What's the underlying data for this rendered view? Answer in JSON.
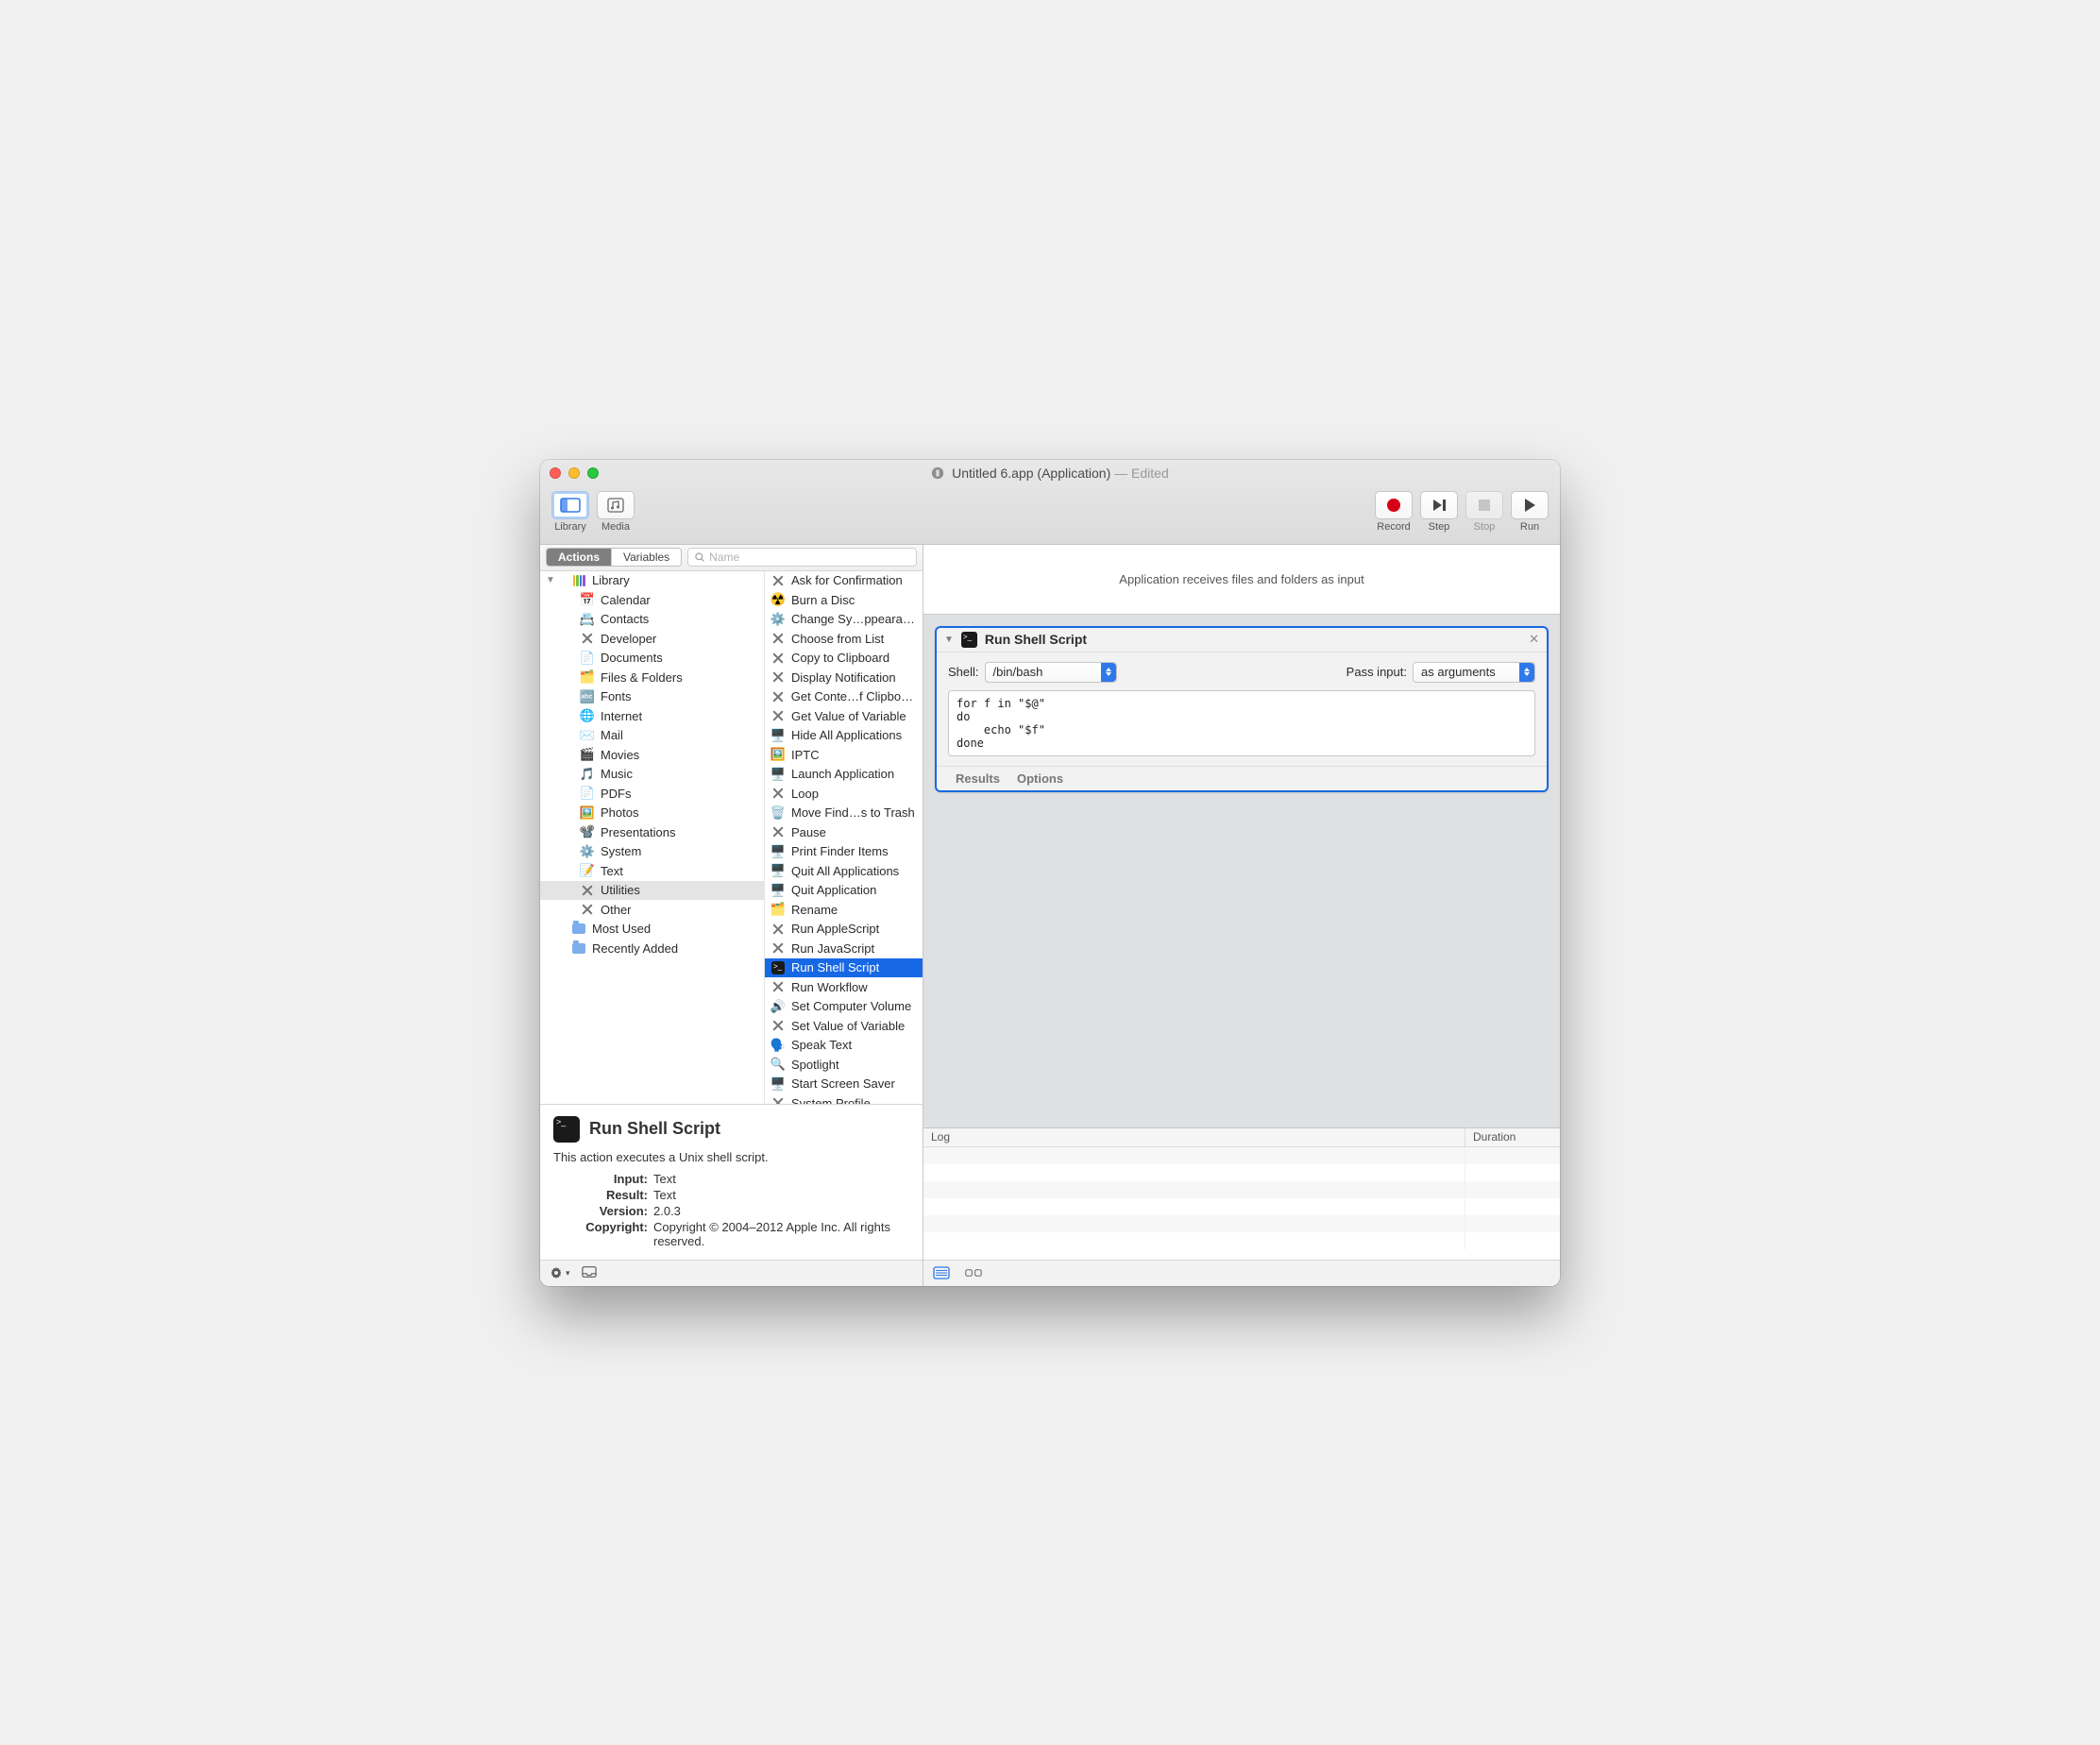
{
  "window": {
    "title_main": "Untitled 6.app (Application)",
    "title_suffix": " — Edited"
  },
  "toolbar": {
    "library": "Library",
    "media": "Media",
    "record": "Record",
    "step": "Step",
    "stop": "Stop",
    "run": "Run"
  },
  "lib_header": {
    "seg_actions": "Actions",
    "seg_variables": "Variables",
    "search_placeholder": "Name"
  },
  "categories": [
    {
      "label": "Library",
      "icon": "library-stack",
      "indent": 0,
      "disclosure": true
    },
    {
      "label": "Calendar",
      "icon": "📅",
      "indent": 1
    },
    {
      "label": "Contacts",
      "icon": "📇",
      "indent": 1
    },
    {
      "label": "Developer",
      "icon": "xtools",
      "indent": 1
    },
    {
      "label": "Documents",
      "icon": "📄",
      "indent": 1
    },
    {
      "label": "Files & Folders",
      "icon": "🗂️",
      "indent": 1
    },
    {
      "label": "Fonts",
      "icon": "🔤",
      "indent": 1
    },
    {
      "label": "Internet",
      "icon": "🌐",
      "indent": 1
    },
    {
      "label": "Mail",
      "icon": "✉️",
      "indent": 1
    },
    {
      "label": "Movies",
      "icon": "🎬",
      "indent": 1
    },
    {
      "label": "Music",
      "icon": "🎵",
      "indent": 1
    },
    {
      "label": "PDFs",
      "icon": "📄",
      "indent": 1
    },
    {
      "label": "Photos",
      "icon": "🖼️",
      "indent": 1
    },
    {
      "label": "Presentations",
      "icon": "📽️",
      "indent": 1
    },
    {
      "label": "System",
      "icon": "⚙️",
      "indent": 1
    },
    {
      "label": "Text",
      "icon": "📝",
      "indent": 1
    },
    {
      "label": "Utilities",
      "icon": "xtools",
      "indent": 1,
      "selected": true
    },
    {
      "label": "Other",
      "icon": "xtools",
      "indent": 1
    },
    {
      "label": "Most Used",
      "icon": "folder",
      "indent": 0
    },
    {
      "label": "Recently Added",
      "icon": "folder",
      "indent": 0
    }
  ],
  "actions": [
    {
      "label": "Ask for Confirmation",
      "icon": "xtools"
    },
    {
      "label": "Burn a Disc",
      "icon": "☢️"
    },
    {
      "label": "Change Sy…ppearance",
      "icon": "⚙️"
    },
    {
      "label": "Choose from List",
      "icon": "xtools"
    },
    {
      "label": "Copy to Clipboard",
      "icon": "xtools"
    },
    {
      "label": "Display Notification",
      "icon": "xtools"
    },
    {
      "label": "Get Conte…f Clipboard",
      "icon": "xtools"
    },
    {
      "label": "Get Value of Variable",
      "icon": "xtools"
    },
    {
      "label": "Hide All Applications",
      "icon": "🖥️"
    },
    {
      "label": "IPTC",
      "icon": "🖼️"
    },
    {
      "label": "Launch Application",
      "icon": "🖥️"
    },
    {
      "label": "Loop",
      "icon": "xtools"
    },
    {
      "label": "Move Find…s to Trash",
      "icon": "🗑️"
    },
    {
      "label": "Pause",
      "icon": "xtools"
    },
    {
      "label": "Print Finder Items",
      "icon": "🖥️"
    },
    {
      "label": "Quit All Applications",
      "icon": "🖥️"
    },
    {
      "label": "Quit Application",
      "icon": "🖥️"
    },
    {
      "label": "Rename",
      "icon": "🗂️"
    },
    {
      "label": "Run AppleScript",
      "icon": "xtools"
    },
    {
      "label": "Run JavaScript",
      "icon": "xtools"
    },
    {
      "label": "Run Shell Script",
      "icon": "term",
      "selected": true
    },
    {
      "label": "Run Workflow",
      "icon": "xtools"
    },
    {
      "label": "Set Computer Volume",
      "icon": "🔊"
    },
    {
      "label": "Set Value of Variable",
      "icon": "xtools"
    },
    {
      "label": "Speak Text",
      "icon": "🗣️"
    },
    {
      "label": "Spotlight",
      "icon": "🔍"
    },
    {
      "label": "Start Screen Saver",
      "icon": "🖥️"
    },
    {
      "label": "System Profile",
      "icon": "xtools"
    }
  ],
  "desc": {
    "title": "Run Shell Script",
    "body": "This action executes a Unix shell script.",
    "meta": {
      "input_k": "Input:",
      "input_v": "Text",
      "result_k": "Result:",
      "result_v": "Text",
      "version_k": "Version:",
      "version_v": "2.0.3",
      "copyright_k": "Copyright:",
      "copyright_v": "Copyright © 2004–2012 Apple Inc.  All rights reserved."
    }
  },
  "workflow": {
    "receives": "Application receives files and folders as input",
    "card": {
      "title": "Run Shell Script",
      "shell_label": "Shell:",
      "shell_value": "/bin/bash",
      "pass_label": "Pass input:",
      "pass_value": "as arguments",
      "script": "for f in \"$@\"\ndo\n    echo \"$f\"\ndone",
      "results": "Results",
      "options": "Options"
    }
  },
  "log": {
    "col_log": "Log",
    "col_duration": "Duration"
  }
}
